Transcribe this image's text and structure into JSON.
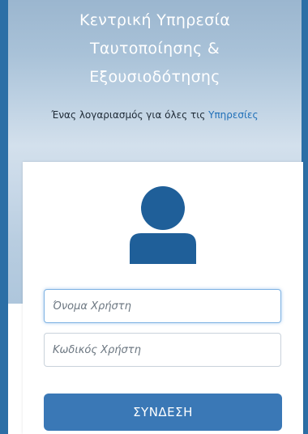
{
  "header": {
    "title_line1": "Κεντρική Υπηρεσία",
    "title_line2": "Ταυτοποίησης &",
    "title_line3": "Εξουσιοδότησης",
    "subtitle_text": "Ένας λογαριασμός για όλες τις ",
    "subtitle_link": "Υπηρεσίες"
  },
  "login": {
    "avatar_icon": "user-icon",
    "username_placeholder": "Όνομα Χρήστη",
    "username_value": "",
    "password_placeholder": "Κωδικός Χρήστη",
    "password_value": "",
    "submit_label": "ΣΥΝΔΕΣΗ"
  },
  "colors": {
    "frame": "#2c6fa6",
    "button": "#3a78b6",
    "link": "#1f6fb8"
  }
}
